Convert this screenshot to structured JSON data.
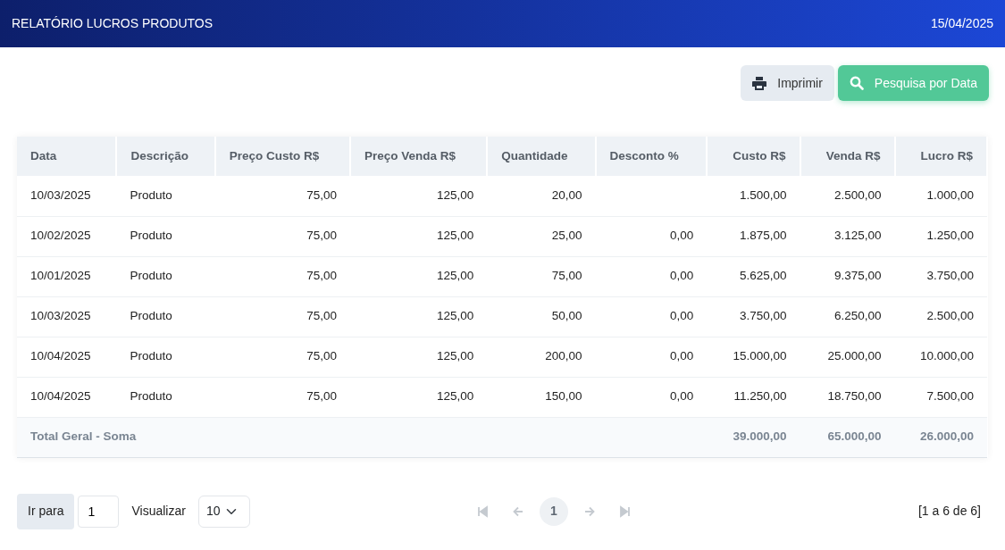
{
  "header": {
    "title": "RELATÓRIO LUCROS PRODUTOS",
    "date": "15/04/2025"
  },
  "actions": [
    {
      "kind": "print",
      "label": "Imprimir"
    },
    {
      "kind": "search",
      "label": "Pesquisa por Data"
    }
  ],
  "table": {
    "columns": [
      {
        "label": "Data",
        "kind": "text"
      },
      {
        "label": "Descrição",
        "kind": "text"
      },
      {
        "label": "Preço Custo R$",
        "kind": "number"
      },
      {
        "label": "Preço Venda R$",
        "kind": "number"
      },
      {
        "label": "Quantidade",
        "kind": "number"
      },
      {
        "label": "Desconto %",
        "kind": "number"
      },
      {
        "label": "Custo R$",
        "kind": "total"
      },
      {
        "label": "Venda R$",
        "kind": "total"
      },
      {
        "label": "Lucro R$",
        "kind": "total"
      }
    ],
    "rows": [
      [
        "10/03/2025",
        "Produto",
        "75,00",
        "125,00",
        "20,00",
        "",
        "1.500,00",
        "2.500,00",
        "1.000,00"
      ],
      [
        "10/02/2025",
        "Produto",
        "75,00",
        "125,00",
        "25,00",
        "0,00",
        "1.875,00",
        "3.125,00",
        "1.250,00"
      ],
      [
        "10/01/2025",
        "Produto",
        "75,00",
        "125,00",
        "75,00",
        "0,00",
        "5.625,00",
        "9.375,00",
        "3.750,00"
      ],
      [
        "10/03/2025",
        "Produto",
        "75,00",
        "125,00",
        "50,00",
        "0,00",
        "3.750,00",
        "6.250,00",
        "2.500,00"
      ],
      [
        "10/04/2025",
        "Produto",
        "75,00",
        "125,00",
        "200,00",
        "0,00",
        "15.000,00",
        "25.000,00",
        "10.000,00"
      ],
      [
        "10/04/2025",
        "Produto",
        "75,00",
        "125,00",
        "150,00",
        "0,00",
        "11.250,00",
        "18.750,00",
        "7.500,00"
      ]
    ],
    "footer": {
      "label": "Total Geral - Soma",
      "totals": [
        "39.000,00",
        "65.000,00",
        "26.000,00"
      ]
    }
  },
  "pager": {
    "goto_label": "Ir para",
    "goto_value": "1",
    "view_label": "Visualizar",
    "page_size": "10",
    "nav": [
      {
        "kind": "first",
        "disabled": true
      },
      {
        "kind": "prev",
        "disabled": true
      },
      {
        "kind": "page",
        "label": "1",
        "selected": true
      },
      {
        "kind": "next",
        "disabled": true
      },
      {
        "kind": "last",
        "disabled": true
      }
    ],
    "summary": "[1 a 6 de 6]"
  }
}
